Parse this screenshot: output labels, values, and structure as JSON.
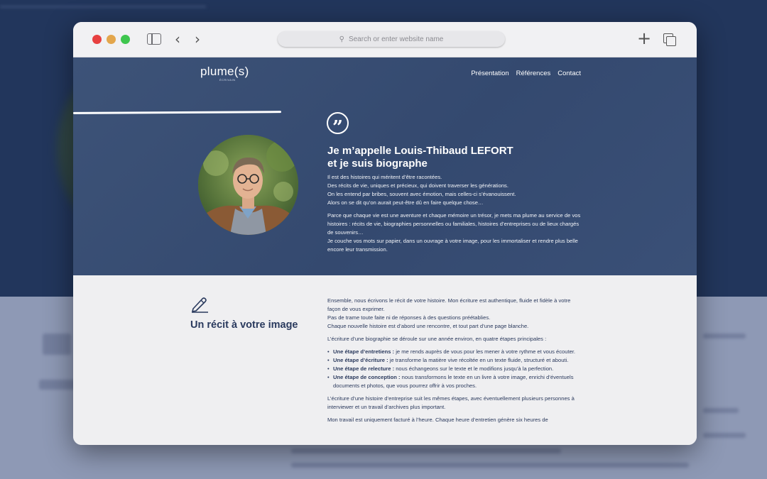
{
  "browser": {
    "address_placeholder": "Search or enter website name",
    "back_icon": "‹",
    "forward_icon": "›",
    "new_tab_icon": "+"
  },
  "site": {
    "logo": "plume(s)",
    "logo_sub": "ÉCRIVAIN",
    "nav": [
      "Présentation",
      "Références",
      "Contact"
    ]
  },
  "hero": {
    "title_line1": "Je m’appelle Louis-Thibaud LEFORT",
    "title_line2": "et je suis biographe",
    "paragraphs": [
      "Il est des histoires qui méritent d’être racontées.\nDes récits de vie, uniques et précieux, qui doivent traverser les générations.\nOn les entend par bribes, souvent avec émotion, mais celles-ci s’évanouissent.\nAlors on se dit qu’on aurait peut-être dû en faire quelque chose…",
      "Parce que chaque vie est une aventure et chaque mémoire un trésor, je mets ma plume au service de vos histoires : récits de vie, biographies personnelles ou familiales, histoires d’entreprises ou de lieux chargés de souvenirs…\nJe couche vos mots sur papier, dans un ouvrage à votre image, pour les immortaliser et rendre plus belle encore leur transmission."
    ]
  },
  "section": {
    "title": "Un récit à votre image",
    "intro": "Ensemble, nous écrivons le récit de votre histoire. Mon écriture est authentique, fluide et fidèle à votre façon de vous exprimer.\nPas de trame toute faite ni de réponses à des questions préétablies.\nChaque nouvelle histoire est d’abord une rencontre, et tout part d’une page blanche.",
    "steps_intro": "L’écriture d’une biographie se déroule sur une année environ, en quatre étapes principales :",
    "steps": [
      {
        "label": "Une étape d’entretiens :",
        "text": " je me rends auprès de vous pour les mener à votre rythme et vous écouter."
      },
      {
        "label": "Une étape d’écriture :",
        "text": " je transforme la matière vive récoltée en un texte fluide, structuré et abouti."
      },
      {
        "label": "Une étape de relecture :",
        "text": " nous échangeons sur le texte et le modifions jusqu’à la perfection."
      },
      {
        "label": "Une étape de conception :",
        "text": " nous transformons le texte en un livre à votre image, enrichi d’éventuels documents et photos, que vous pourrez offrir à vos proches."
      }
    ],
    "enterprise": "L’écriture d’une histoire d’entreprise suit les mêmes étapes, avec éventuellement plusieurs personnes à interviewer et un travail d’archives plus important.",
    "pricing": "Mon travail est uniquement facturé à l’heure. Chaque heure d’entretien génère six heures de"
  }
}
